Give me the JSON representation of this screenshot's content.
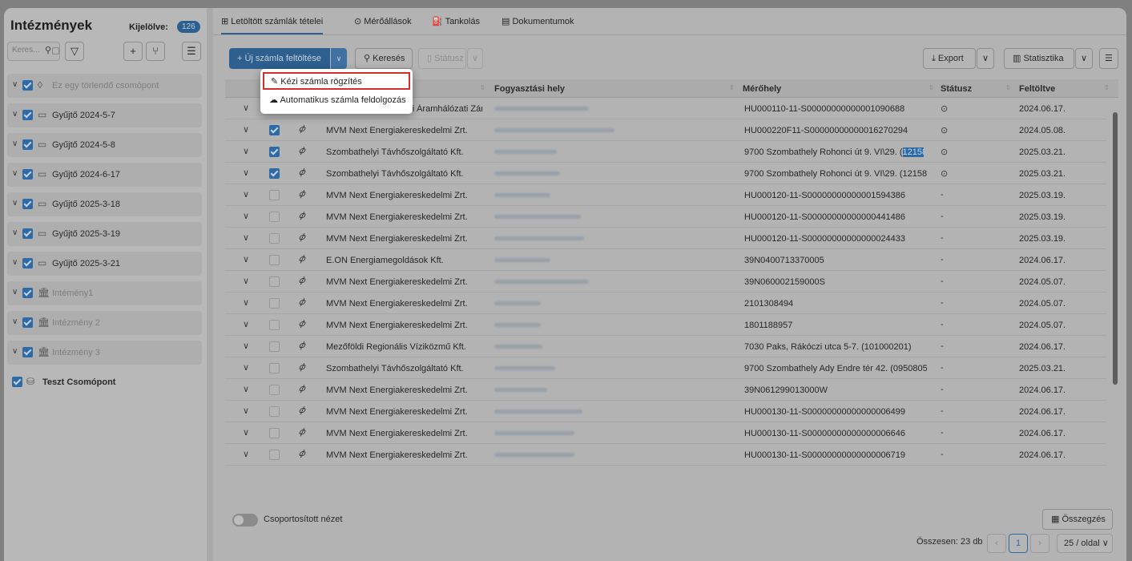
{
  "left_panel": {
    "title": "Intézmények",
    "selected_label": "Kijelölve:",
    "selected_count": "126",
    "search_placeholder": "Keres...",
    "tree": [
      {
        "label": "Ez egy törlendő csomópont",
        "icon": "drop-icon",
        "dim": true
      },
      {
        "label": "Gyűjtő 2024-5-7",
        "icon": "folder-icon",
        "dim": false
      },
      {
        "label": "Gyűjtő 2024-5-8",
        "icon": "folder-icon",
        "dim": false
      },
      {
        "label": "Gyűjtő 2024-6-17",
        "icon": "folder-icon",
        "dim": false
      },
      {
        "label": "Gyűjtő 2025-3-18",
        "icon": "folder-icon",
        "dim": false
      },
      {
        "label": "Gyűjtő 2025-3-19",
        "icon": "folder-icon",
        "dim": false
      },
      {
        "label": "Gyűjtő 2025-3-21",
        "icon": "folder-icon",
        "dim": false
      },
      {
        "label": "Intémény1",
        "icon": "institution-icon",
        "dim": true
      },
      {
        "label": "Intézmény 2",
        "icon": "institution-icon",
        "dim": true
      },
      {
        "label": "Intézmény 3",
        "icon": "institution-icon",
        "dim": true
      },
      {
        "label": "Teszt Csomópont",
        "icon": "package-icon",
        "dim": false
      }
    ]
  },
  "tabs": [
    {
      "label": "Letöltött számlák tételei",
      "icon": "invoice-icon",
      "active": true
    },
    {
      "label": "Mérőállások",
      "icon": "gauge-icon",
      "active": false
    },
    {
      "label": "Tankolás",
      "icon": "fuel-icon",
      "active": false
    },
    {
      "label": "Dokumentumok",
      "icon": "document-icon",
      "active": false
    }
  ],
  "toolbar": {
    "upload_label": "Új számla feltöltése",
    "search_label": "Keresés",
    "status_label": "Státusz",
    "export_label": "Export",
    "statistics_label": "Statisztika"
  },
  "dropdown": {
    "manual_label": "Kézi számla rögzítés",
    "auto_label": "Automatikus számla feldolgozás"
  },
  "table": {
    "columns": [
      "Fogyasztási hely",
      "Mérőhely",
      "Státusz",
      "Feltöltve"
    ],
    "rows": [
      {
        "supplier": "E.ON Észak-Dunántúli Áramhálózati Zárt...",
        "meter": "HU000110-11-S00000000000001090688",
        "status": "⊙",
        "uploaded": "2024.06.17.",
        "checked": true
      },
      {
        "supplier": "MVM Next Energiakereskedelmi Zrt.",
        "meter": "HU000220F11-S00000000000016270294",
        "status": "⊙",
        "uploaded": "2024.05.08.",
        "checked": true
      },
      {
        "supplier": "Szombathelyi Távhőszolgáltató Kft.",
        "meter_pre": "9700 Szombathely Rohonci út 9. VI\\29. (",
        "meter_hl": "12158",
        "meter_post": "...",
        "status": "⊙",
        "uploaded": "2025.03.21.",
        "checked": true
      },
      {
        "supplier": "Szombathelyi Távhőszolgáltató Kft.",
        "meter": "9700 Szombathely Rohonci út 9. VI\\29. (12158...",
        "status": "⊙",
        "uploaded": "2025.03.21.",
        "checked": true
      },
      {
        "supplier": "MVM Next Energiakereskedelmi Zrt.",
        "meter": "HU000120-11-S00000000000001594386",
        "status": "-",
        "uploaded": "2025.03.19.",
        "checked": false
      },
      {
        "supplier": "MVM Next Energiakereskedelmi Zrt.",
        "meter": "HU000120-11-S00000000000000441486",
        "status": "-",
        "uploaded": "2025.03.19.",
        "checked": false
      },
      {
        "supplier": "MVM Next Energiakereskedelmi Zrt.",
        "meter": "HU000120-11-S00000000000000024433",
        "status": "-",
        "uploaded": "2025.03.19.",
        "checked": false
      },
      {
        "supplier": "E.ON Energiamegoldások Kft.",
        "meter": "39N0400713370005",
        "status": "-",
        "uploaded": "2024.06.17.",
        "checked": false
      },
      {
        "supplier": "MVM Next Energiakereskedelmi Zrt.",
        "meter": "39N060002159000S",
        "status": "-",
        "uploaded": "2024.05.07.",
        "checked": false
      },
      {
        "supplier": "MVM Next Energiakereskedelmi Zrt.",
        "meter": "2101308494",
        "status": "-",
        "uploaded": "2024.05.07.",
        "checked": false
      },
      {
        "supplier": "MVM Next Energiakereskedelmi Zrt.",
        "meter": "1801188957",
        "status": "-",
        "uploaded": "2024.05.07.",
        "checked": false
      },
      {
        "supplier": "Mezőföldi Regionális Víziközmű Kft.",
        "meter": "7030 Paks, Rákóczi utca 5-7. (101000201)",
        "status": "-",
        "uploaded": "2024.06.17.",
        "checked": false
      },
      {
        "supplier": "Szombathelyi Távhőszolgáltató Kft.",
        "meter": "9700 Szombathely Ady Endre tér 42. (0950805 ...",
        "status": "-",
        "uploaded": "2025.03.21.",
        "checked": false
      },
      {
        "supplier": "MVM Next Energiakereskedelmi Zrt.",
        "meter": "39N061299013000W",
        "status": "-",
        "uploaded": "2024.06.17.",
        "checked": false
      },
      {
        "supplier": "MVM Next Energiakereskedelmi Zrt.",
        "meter": "HU000130-11-S00000000000000006499",
        "status": "-",
        "uploaded": "2024.06.17.",
        "checked": false
      },
      {
        "supplier": "MVM Next Energiakereskedelmi Zrt.",
        "meter": "HU000130-11-S00000000000000006646",
        "status": "-",
        "uploaded": "2024.06.17.",
        "checked": false
      },
      {
        "supplier": "MVM Next Energiakereskedelmi Zrt.",
        "meter": "HU000130-11-S00000000000000006719",
        "status": "-",
        "uploaded": "2024.06.17.",
        "checked": false
      }
    ]
  },
  "footer": {
    "grouped_view_label": "Csoportosított nézet",
    "summary_label": "Összegzés",
    "total_label": "Összesen: 23 db",
    "current_page": "1",
    "page_size": "25 / oldal"
  }
}
